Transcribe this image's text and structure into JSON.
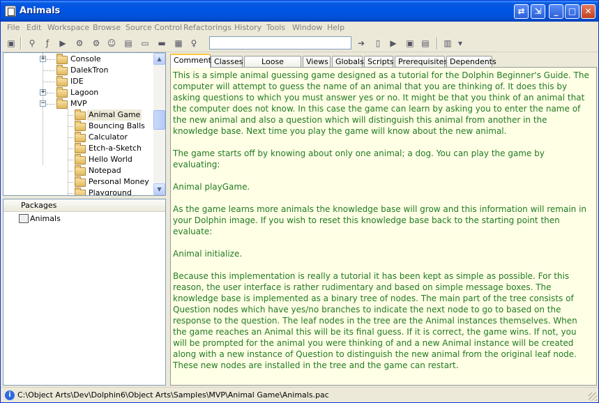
{
  "window": {
    "title": "Animals"
  },
  "menu": [
    "File",
    "Edit",
    "Workspace",
    "Browse",
    "Source Control",
    "Refactorings",
    "History",
    "Tools",
    "Window",
    "Help"
  ],
  "toolbar": {
    "search_value": ""
  },
  "tree": {
    "items": [
      {
        "label": "Console",
        "expander": "+",
        "level": 1
      },
      {
        "label": "DalekTron",
        "expander": "",
        "level": 1
      },
      {
        "label": "IDE",
        "expander": "",
        "level": 1
      },
      {
        "label": "Lagoon",
        "expander": "+",
        "level": 1
      },
      {
        "label": "MVP",
        "expander": "−",
        "level": 1
      },
      {
        "label": "Animal Game",
        "expander": "",
        "level": 2,
        "selected": true
      },
      {
        "label": "Bouncing Balls",
        "expander": "",
        "level": 2
      },
      {
        "label": "Calculator",
        "expander": "",
        "level": 2
      },
      {
        "label": "Etch-a-Sketch",
        "expander": "",
        "level": 2
      },
      {
        "label": "Hello World",
        "expander": "",
        "level": 2
      },
      {
        "label": "Notepad",
        "expander": "",
        "level": 2
      },
      {
        "label": "Personal Money",
        "expander": "",
        "level": 2
      },
      {
        "label": "Playground",
        "expander": "",
        "level": 2
      }
    ]
  },
  "packages": {
    "header": "Packages",
    "items": [
      "Animals"
    ]
  },
  "tabs": [
    "Comment",
    "Classes",
    "Loose Methods",
    "Views",
    "Globals",
    "Scripts",
    "Prerequisites",
    "Dependents"
  ],
  "comment": {
    "paragraphs": [
      "This is a simple animal guessing game designed as a tutorial for the Dolphin Beginner's Guide. The computer will attempt to guess the name of an animal that you are thinking of. It does this by asking questions to which you must answer yes or no. It might be that you think of an animal that the computer does not know. In this case the game can learn by asking you to enter the name of the new animal and also a question which will distinguish this animal from another in the knowledge base. Next time you play the game will know about the new animal.",
      "The game starts off by knowing about only one animal; a dog. You can play the game by evaluating:",
      "Animal playGame.",
      "As the game learns more animals the knowledge base will grow and this information will remain in your Dolphin image. If you wish to reset this knowledge base back to the starting point then evaluate:",
      "Animal initialize.",
      "Because this implementation is really a tutorial it has been kept as simple as possible. For this reason, the user interface is rather rudimentary and based on simple message boxes. The knowledge base is implemented as a binary tree of nodes. The main part of the tree consists of Question nodes which have yes/no branches to indicate the next node to go to based on the response to the question. The leaf nodes in the tree are the Animal instances themselves. When the game reaches an Animal this will be its final guess. If it is correct, the game wins. If not, you will be prompted for the animal you were thinking of and a new Animal instance will be created along with a new instance of Question to distinguish the new animal from the original leaf node. These new nodes are installed in the tree and the game can restart."
    ]
  },
  "status": {
    "path": "C:\\Object Arts\\Dev\\Dolphin6\\Object Arts\\Samples\\MVP\\Animal Game\\Animals.pac"
  }
}
